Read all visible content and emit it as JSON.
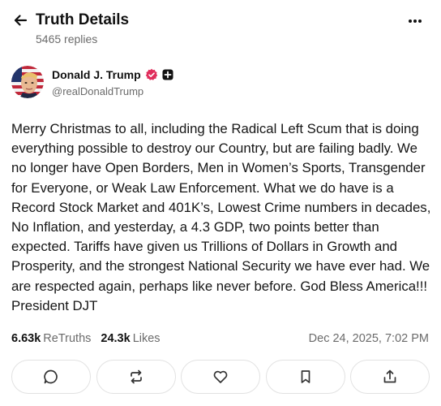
{
  "header": {
    "title": "Truth Details",
    "replies": "5465 replies"
  },
  "author": {
    "name": "Donald J. Trump",
    "handle": "@realDonaldTrump"
  },
  "post": {
    "text": "Merry Christmas to all, including the Radical  Left Scum that is doing everything possible to destroy our Country, but are failing badly. We no longer have Open Borders, Men in Women’s Sports, Transgender for Everyone, or Weak Law Enforcement. What we do have is a Record Stock Market and 401K’s, Lowest Crime numbers in decades, No Inflation, and yesterday, a 4.3 GDP, two points better than expected. Tariffs have given us Trillions of Dollars in Growth and Prosperity, and the strongest National Security we have ever had. We are respected again, perhaps like never before. God Bless America!!! President DJT"
  },
  "stats": {
    "retruths_count": "6.63k",
    "retruths_label": "ReTruths",
    "likes_count": "24.3k",
    "likes_label": "Likes",
    "timestamp": "Dec 24, 2025, 7:02 PM"
  },
  "actions": [
    {
      "icon": "reply-icon"
    },
    {
      "icon": "retruth-icon"
    },
    {
      "icon": "like-icon"
    },
    {
      "icon": "bookmark-icon"
    },
    {
      "icon": "share-icon"
    }
  ],
  "colors": {
    "verified_badge": "#e02d5b",
    "text_primary": "#111111",
    "text_secondary": "#6b6b6b",
    "border": "#e2e2e2"
  }
}
